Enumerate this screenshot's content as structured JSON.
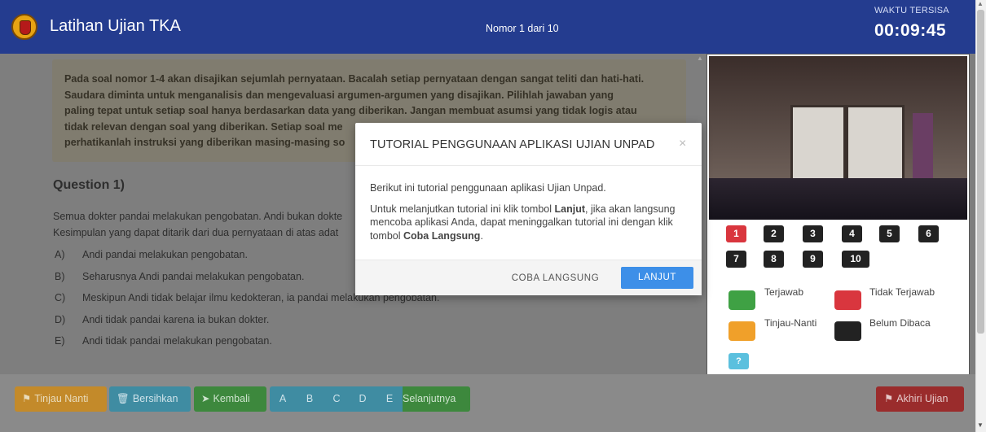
{
  "header": {
    "title": "Latihan Ujian TKA",
    "counter": "Nomor 1 dari 10",
    "timer_label": "WAKTU TERSISA",
    "timer_value": "00:09:45"
  },
  "instructions": {
    "lines": [
      "Pada soal nomor 1-4 akan disajikan sejumlah pernyataan. Bacalah setiap pernyataan dengan sangat teliti dan hati-hati.",
      "Saudara diminta untuk menganalisis dan mengevaluasi argumen-argumen yang disajikan. Pilihlah jawaban yang",
      "paling tepat untuk setiap soal hanya berdasarkan data yang diberikan. Jangan membuat asumsi yang tidak logis atau",
      "tidak relevan dengan soal yang diberikan. Setiap soal me",
      "perhatikanlah instruksi yang diberikan masing-masing so"
    ]
  },
  "question": {
    "heading": "Question 1)",
    "text_lines": [
      "Semua dokter pandai melakukan pengobatan. Andi bukan dokte",
      "Kesimpulan yang dapat ditarik dari dua pernyataan di atas adat"
    ],
    "options": [
      {
        "letter": "A)",
        "text": "Andi pandai melakukan pengobatan."
      },
      {
        "letter": "B)",
        "text": "Seharusnya Andi pandai melakukan pengobatan."
      },
      {
        "letter": "C)",
        "text": "Meskipun Andi tidak belajar ilmu kedokteran, ia pandai melakukan pengobatan."
      },
      {
        "letter": "D)",
        "text": "Andi tidak pandai karena ia bukan dokter."
      },
      {
        "letter": "E)",
        "text": "Andi tidak pandai melakukan pengobatan."
      }
    ]
  },
  "nav": {
    "numbers": [
      "1",
      "2",
      "3",
      "4",
      "5",
      "6",
      "7",
      "8",
      "9",
      "10"
    ],
    "active": "1"
  },
  "legend": {
    "answered": "Terjawab",
    "not_answered": "Tidak Terjawab",
    "review_later": "Tinjau-Nanti",
    "unread": "Belum Dibaca",
    "help": "?"
  },
  "footer": {
    "tinjau": "Tinjau Nanti",
    "bersihkan": "Bersihkan",
    "kembali": "Kembali",
    "answers": [
      "A",
      "B",
      "C",
      "D",
      "E"
    ],
    "selanjutnya": "Selanjutnya",
    "akhiri": "Akhiri Ujian"
  },
  "modal": {
    "title": "TUTORIAL PENGGUNAAN APLIKASI UJIAN UNPAD",
    "close": "×",
    "p1": "Berikut ini tutorial penggunaan aplikasi Ujian Unpad.",
    "p2_a": "Untuk melanjutkan tutorial ini klik tombol ",
    "p2_b": "Lanjut",
    "p2_c": ", jika akan langsung mencoba aplikasi Anda, dapat meninggalkan tutorial ini dengan klik tombol ",
    "p2_d": "Coba Langsung",
    "p2_e": ".",
    "btn_coba": "COBA LANGSUNG",
    "btn_lanjut": "LANJUT"
  },
  "colors": {
    "header": "#243c8f",
    "answered": "#3fa144",
    "not_answered": "#d9363e",
    "review_later": "#f0a02a",
    "unread": "#222222",
    "primary": "#3d8fe8"
  }
}
